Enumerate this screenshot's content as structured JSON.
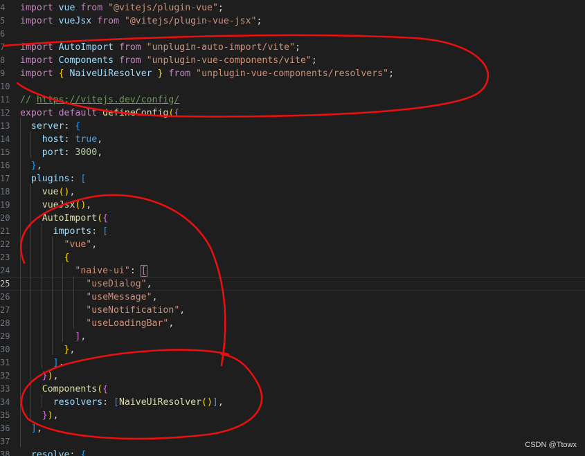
{
  "editor": {
    "lines": [
      {
        "n": "4",
        "tokens": [
          [
            "kw",
            "import"
          ],
          [
            "pn",
            " "
          ],
          [
            "var",
            "vue"
          ],
          [
            "pn",
            " "
          ],
          [
            "kw",
            "from"
          ],
          [
            "pn",
            " "
          ],
          [
            "str",
            "\"@vitejs/plugin-vue\""
          ],
          [
            "pn",
            ";"
          ]
        ]
      },
      {
        "n": "5",
        "tokens": [
          [
            "kw",
            "import"
          ],
          [
            "pn",
            " "
          ],
          [
            "var",
            "vueJsx"
          ],
          [
            "pn",
            " "
          ],
          [
            "kw",
            "from"
          ],
          [
            "pn",
            " "
          ],
          [
            "str",
            "\"@vitejs/plugin-vue-jsx\""
          ],
          [
            "pn",
            ";"
          ]
        ]
      },
      {
        "n": "6",
        "tokens": []
      },
      {
        "n": "7",
        "tokens": [
          [
            "kw",
            "import"
          ],
          [
            "pn",
            " "
          ],
          [
            "var",
            "AutoImport"
          ],
          [
            "pn",
            " "
          ],
          [
            "kw",
            "from"
          ],
          [
            "pn",
            " "
          ],
          [
            "str",
            "\"unplugin-auto-import/vite\""
          ],
          [
            "pn",
            ";"
          ]
        ]
      },
      {
        "n": "8",
        "tokens": [
          [
            "kw",
            "import"
          ],
          [
            "pn",
            " "
          ],
          [
            "var",
            "Components"
          ],
          [
            "pn",
            " "
          ],
          [
            "kw",
            "from"
          ],
          [
            "pn",
            " "
          ],
          [
            "str",
            "\"unplugin-vue-components/vite\""
          ],
          [
            "pn",
            ";"
          ]
        ]
      },
      {
        "n": "9",
        "tokens": [
          [
            "kw",
            "import"
          ],
          [
            "pn",
            " "
          ],
          [
            "b1",
            "{"
          ],
          [
            "pn",
            " "
          ],
          [
            "var",
            "NaiveUiResolver"
          ],
          [
            "pn",
            " "
          ],
          [
            "b1",
            "}"
          ],
          [
            "pn",
            " "
          ],
          [
            "kw",
            "from"
          ],
          [
            "pn",
            " "
          ],
          [
            "str",
            "\"unplugin-vue-components/resolvers\""
          ],
          [
            "pn",
            ";"
          ]
        ]
      },
      {
        "n": "10",
        "tokens": []
      },
      {
        "n": "11",
        "tokens": [
          [
            "cm",
            "// "
          ],
          [
            "lnk",
            "https://vitejs.dev/config/"
          ]
        ]
      },
      {
        "n": "12",
        "tokens": [
          [
            "kw",
            "export"
          ],
          [
            "pn",
            " "
          ],
          [
            "kw",
            "default"
          ],
          [
            "pn",
            " "
          ],
          [
            "fn",
            "defineConfig"
          ],
          [
            "b1",
            "("
          ],
          [
            "b2",
            "{"
          ]
        ]
      },
      {
        "n": "13",
        "tokens": [
          [
            "pn",
            "  "
          ],
          [
            "var",
            "server"
          ],
          [
            "pn",
            ": "
          ],
          [
            "b3",
            "{"
          ]
        ]
      },
      {
        "n": "14",
        "tokens": [
          [
            "pn",
            "    "
          ],
          [
            "var",
            "host"
          ],
          [
            "pn",
            ": "
          ],
          [
            "kb",
            "true"
          ],
          [
            "pn",
            ","
          ]
        ]
      },
      {
        "n": "15",
        "tokens": [
          [
            "pn",
            "    "
          ],
          [
            "var",
            "port"
          ],
          [
            "pn",
            ": "
          ],
          [
            "num",
            "3000"
          ],
          [
            "pn",
            ","
          ]
        ]
      },
      {
        "n": "16",
        "tokens": [
          [
            "pn",
            "  "
          ],
          [
            "b3",
            "}"
          ],
          [
            "pn",
            ","
          ]
        ]
      },
      {
        "n": "17",
        "tokens": [
          [
            "pn",
            "  "
          ],
          [
            "var",
            "plugins"
          ],
          [
            "pn",
            ": "
          ],
          [
            "b3",
            "["
          ]
        ]
      },
      {
        "n": "18",
        "tokens": [
          [
            "pn",
            "    "
          ],
          [
            "fn",
            "vue"
          ],
          [
            "b1",
            "()"
          ],
          [
            "pn",
            ","
          ]
        ]
      },
      {
        "n": "19",
        "tokens": [
          [
            "pn",
            "    "
          ],
          [
            "fn",
            "vueJsx"
          ],
          [
            "b1",
            "()"
          ],
          [
            "pn",
            ","
          ]
        ]
      },
      {
        "n": "20",
        "tokens": [
          [
            "pn",
            "    "
          ],
          [
            "fn",
            "AutoImport"
          ],
          [
            "b1",
            "("
          ],
          [
            "b2",
            "{"
          ]
        ]
      },
      {
        "n": "21",
        "tokens": [
          [
            "pn",
            "      "
          ],
          [
            "var",
            "imports"
          ],
          [
            "pn",
            ": "
          ],
          [
            "b3",
            "["
          ]
        ]
      },
      {
        "n": "22",
        "tokens": [
          [
            "pn",
            "        "
          ],
          [
            "str",
            "\"vue\""
          ],
          [
            "pn",
            ","
          ]
        ]
      },
      {
        "n": "23",
        "tokens": [
          [
            "pn",
            "        "
          ],
          [
            "b1",
            "{"
          ]
        ]
      },
      {
        "n": "24",
        "tokens": [
          [
            "pn",
            "          "
          ],
          [
            "str",
            "\"naive-ui\""
          ],
          [
            "pn",
            ": "
          ],
          [
            "b2h",
            "["
          ]
        ]
      },
      {
        "n": "25",
        "tokens": [
          [
            "pn",
            "            "
          ],
          [
            "str",
            "\"useDialog\""
          ],
          [
            "pn",
            ","
          ]
        ]
      },
      {
        "n": "26",
        "tokens": [
          [
            "pn",
            "            "
          ],
          [
            "str",
            "\"useMessage\""
          ],
          [
            "pn",
            ","
          ]
        ]
      },
      {
        "n": "27",
        "tokens": [
          [
            "pn",
            "            "
          ],
          [
            "str",
            "\"useNotification\""
          ],
          [
            "pn",
            ","
          ]
        ]
      },
      {
        "n": "28",
        "tokens": [
          [
            "pn",
            "            "
          ],
          [
            "str",
            "\"useLoadingBar\""
          ],
          [
            "pn",
            ","
          ]
        ]
      },
      {
        "n": "29",
        "tokens": [
          [
            "pn",
            "          "
          ],
          [
            "b2",
            "]"
          ],
          [
            "pn",
            ","
          ]
        ]
      },
      {
        "n": "30",
        "tokens": [
          [
            "pn",
            "        "
          ],
          [
            "b1",
            "}"
          ],
          [
            "pn",
            ","
          ]
        ]
      },
      {
        "n": "31",
        "tokens": [
          [
            "pn",
            "      "
          ],
          [
            "b3",
            "]"
          ],
          [
            "pn",
            ","
          ]
        ]
      },
      {
        "n": "32",
        "tokens": [
          [
            "pn",
            "    "
          ],
          [
            "b2",
            "}"
          ],
          [
            "b1",
            ")"
          ],
          [
            "pn",
            ","
          ]
        ]
      },
      {
        "n": "33",
        "tokens": [
          [
            "pn",
            "    "
          ],
          [
            "fn",
            "Components"
          ],
          [
            "b1",
            "("
          ],
          [
            "b2",
            "{"
          ]
        ]
      },
      {
        "n": "34",
        "tokens": [
          [
            "pn",
            "      "
          ],
          [
            "var",
            "resolvers"
          ],
          [
            "pn",
            ": "
          ],
          [
            "b3",
            "["
          ],
          [
            "fn",
            "NaiveUiResolver"
          ],
          [
            "b1",
            "()"
          ],
          [
            "b3",
            "]"
          ],
          [
            "pn",
            ","
          ]
        ]
      },
      {
        "n": "35",
        "tokens": [
          [
            "pn",
            "    "
          ],
          [
            "b2",
            "}"
          ],
          [
            "b1",
            ")"
          ],
          [
            "pn",
            ","
          ]
        ]
      },
      {
        "n": "36",
        "tokens": [
          [
            "pn",
            "  "
          ],
          [
            "b3",
            "]"
          ],
          [
            "pn",
            ","
          ]
        ]
      },
      {
        "n": "37",
        "tokens": []
      },
      {
        "n": "38",
        "tokens": [
          [
            "pn",
            "  "
          ],
          [
            "var",
            "resolve"
          ],
          [
            "pn",
            ": "
          ],
          [
            "b3",
            "{"
          ]
        ]
      }
    ],
    "current_line": "25"
  },
  "annotation_color": "#e81010",
  "watermark": "CSDN @Ttowx"
}
